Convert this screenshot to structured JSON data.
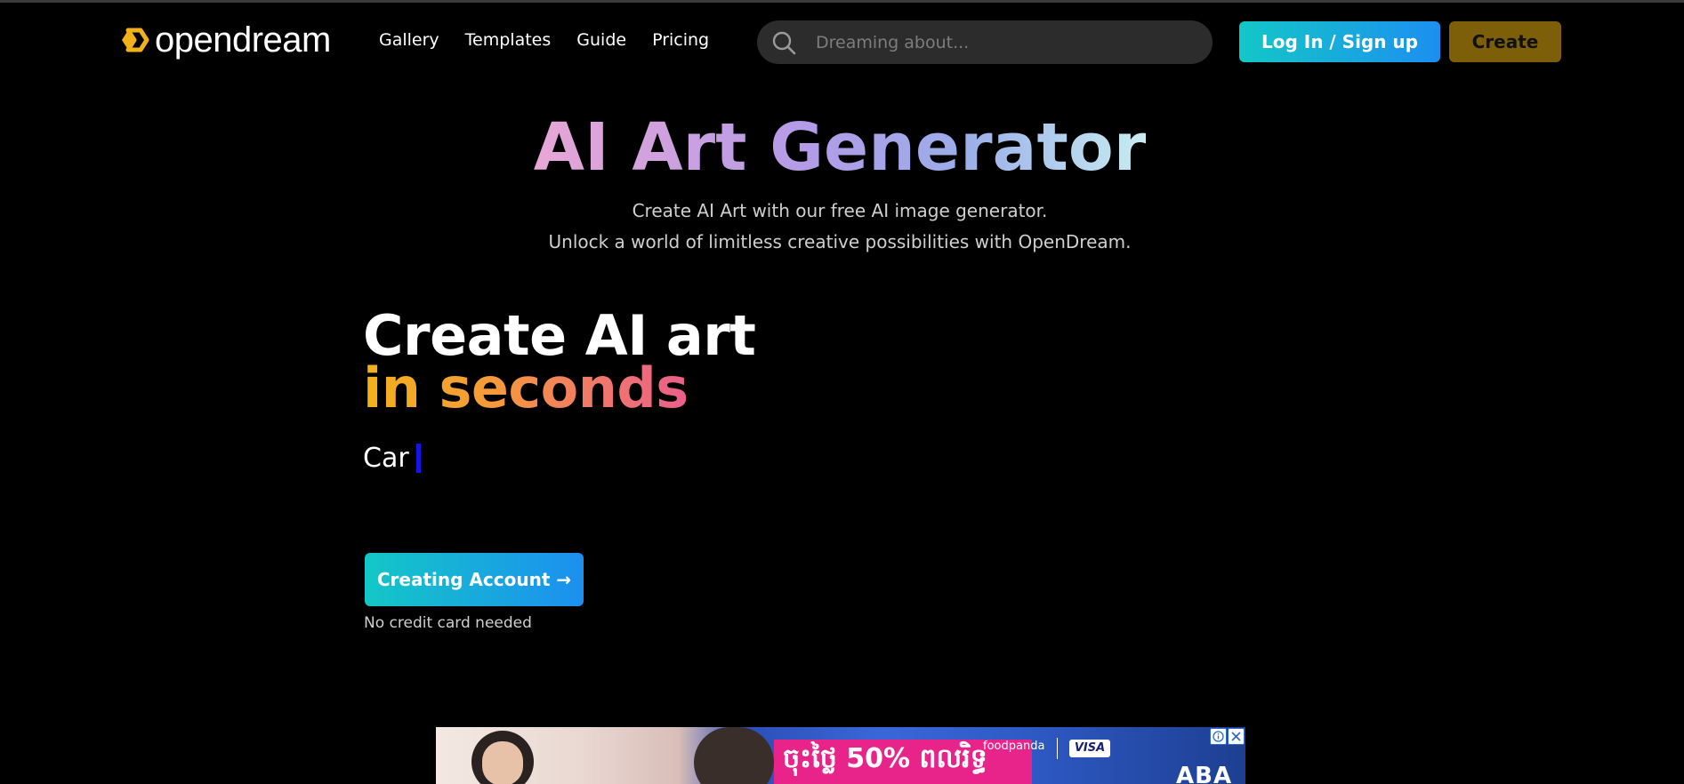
{
  "header": {
    "logo_text": "opendream",
    "nav": [
      "Gallery",
      "Templates",
      "Guide",
      "Pricing"
    ],
    "search_placeholder": "Dreaming about...",
    "login_label": "Log In / Sign up",
    "create_label": "Create"
  },
  "hero": {
    "title": "AI Art Generator",
    "subtitle_1": "Create AI Art with our free AI image generator.",
    "subtitle_2": "Unlock a world of limitless creative possibilities with OpenDream."
  },
  "promo": {
    "heading_line1": "Create AI art",
    "heading_line2": "in seconds",
    "typed_text": "Car",
    "button_label": "Creating Account →",
    "note": "No credit card needed"
  },
  "ad": {
    "promo_text": "ចុះថ្លៃ 50% ពលរិទ្ធ",
    "partner_text": "foodpanda",
    "card_text": "VISA",
    "bank_text": "ABA"
  },
  "colors": {
    "accent_gradient_start": "#13c7c7",
    "accent_gradient_end": "#1c8ff0",
    "create_button": "#7d5e09",
    "logo_mark": "#f2b11b",
    "caret": "#1414e6"
  }
}
